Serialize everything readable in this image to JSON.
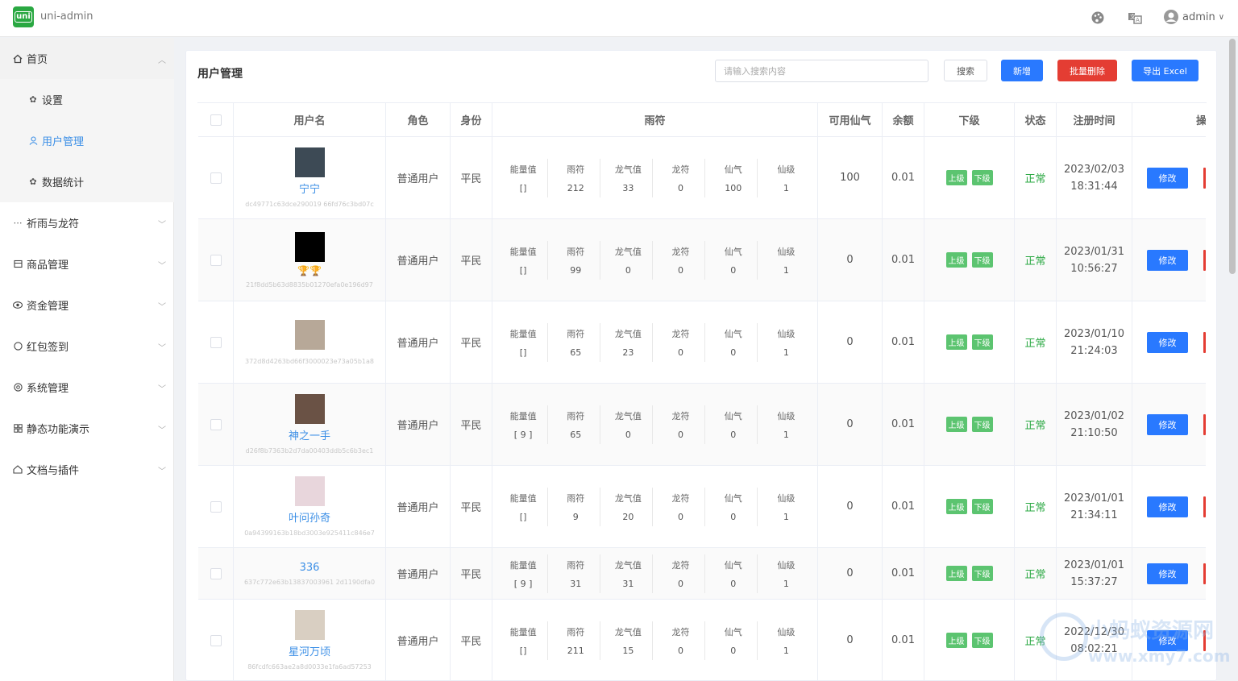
{
  "app": {
    "logo_text": "uni",
    "title": "uni-admin",
    "user": "admin"
  },
  "topbar": {
    "icons": [
      "palette-icon",
      "translate-icon",
      "user-icon"
    ]
  },
  "sidebar": {
    "items": [
      {
        "label": "首页",
        "icon": "home-icon",
        "expanded": true
      },
      {
        "label": "设置",
        "icon": "gear-icon",
        "sub": true
      },
      {
        "label": "用户管理",
        "icon": "user-icon",
        "sub": true,
        "active": true
      },
      {
        "label": "数据统计",
        "icon": "gear-icon",
        "sub": true
      },
      {
        "label": "祈雨与龙符",
        "icon": "dots-icon"
      },
      {
        "label": "商品管理",
        "icon": "box-icon"
      },
      {
        "label": "资金管理",
        "icon": "eye-icon"
      },
      {
        "label": "红包签到",
        "icon": "circle-icon"
      },
      {
        "label": "系统管理",
        "icon": "settings-icon"
      },
      {
        "label": "静态功能演示",
        "icon": "grid-icon"
      },
      {
        "label": "文档与插件",
        "icon": "doc-icon"
      }
    ]
  },
  "panel": {
    "title": "用户管理",
    "search_placeholder": "请输入搜索内容",
    "btn_search": "搜索",
    "btn_add": "新增",
    "btn_batch_delete": "批量删除",
    "btn_export": "导出 Excel"
  },
  "table": {
    "headers": {
      "username": "用户名",
      "role": "角色",
      "identity": "身份",
      "yufu": "雨符",
      "available": "可用仙气",
      "balance": "余额",
      "sub": "下级",
      "status": "状态",
      "reg_time": "注册时间",
      "ops": "操作"
    },
    "yufu_labels": [
      "能量值",
      "雨符",
      "龙气值",
      "龙符",
      "仙气",
      "仙级"
    ],
    "tag_up": "上级",
    "tag_down": "下级",
    "edit_label": "修改",
    "rows": [
      {
        "username": "宁宁",
        "uid": "dc49771c63dce290019 66fd76c3bd07c",
        "avatar": "#3d4a55",
        "role": "普通用户",
        "identity": "平民",
        "yufu": [
          "[]",
          "212",
          "33",
          "0",
          "100",
          "1"
        ],
        "available": "100",
        "balance": "0.01",
        "status": "正常",
        "date": "2023/02/03",
        "time": "18:31:44"
      },
      {
        "username": "",
        "trophies": "🏆🏆",
        "uid": "21f8dd5b63d8835b01270efa0e196d97",
        "avatar": "#000000",
        "role": "普通用户",
        "identity": "平民",
        "yufu": [
          "[]",
          "99",
          "0",
          "0",
          "0",
          "1"
        ],
        "available": "0",
        "balance": "0.01",
        "status": "正常",
        "date": "2023/01/31",
        "time": "10:56:27"
      },
      {
        "username": "",
        "uid": "372d8d4263bd66f3000023e73a05b1a8",
        "avatar": "#b7a898",
        "role": "普通用户",
        "identity": "平民",
        "yufu": [
          "[]",
          "65",
          "23",
          "0",
          "0",
          "1"
        ],
        "available": "0",
        "balance": "0.01",
        "status": "正常",
        "date": "2023/01/10",
        "time": "21:24:03"
      },
      {
        "username": "神之一手",
        "uid": "d26f8b7363b2d7da00403ddb5c6b3ec1",
        "avatar": "#6a5245",
        "role": "普通用户",
        "identity": "平民",
        "yufu": [
          "[ 9 ]",
          "65",
          "0",
          "0",
          "0",
          "1"
        ],
        "available": "0",
        "balance": "0.01",
        "status": "正常",
        "date": "2023/01/02",
        "time": "21:10:50"
      },
      {
        "username": "叶问孙奇",
        "uid": "0a94399163b18bd3003e925411c846e7",
        "avatar": "#e8d6dc",
        "role": "普通用户",
        "identity": "平民",
        "yufu": [
          "[]",
          "9",
          "20",
          "0",
          "0",
          "1"
        ],
        "available": "0",
        "balance": "0.01",
        "status": "正常",
        "date": "2023/01/01",
        "time": "21:34:11"
      },
      {
        "username": "336",
        "uid": "637c772e63b13837003961 2d1190dfa0",
        "avatar": "",
        "role": "普通用户",
        "identity": "平民",
        "yufu": [
          "[ 9 ]",
          "31",
          "31",
          "0",
          "0",
          "1"
        ],
        "available": "0",
        "balance": "0.01",
        "status": "正常",
        "date": "2023/01/01",
        "time": "15:37:27"
      },
      {
        "username": "星河万顷",
        "uid": "86fcdfc663ae2a8d0033e1fa6ad57253",
        "avatar": "#d9cfc2",
        "role": "普通用户",
        "identity": "平民",
        "yufu": [
          "[]",
          "211",
          "15",
          "0",
          "0",
          "1"
        ],
        "available": "0",
        "balance": "0.01",
        "status": "正常",
        "date": "2022/12/30",
        "time": "08:02:21"
      }
    ]
  },
  "watermark": {
    "line1": "小蚂蚁资源网",
    "line2": "www.xmy7.com"
  }
}
